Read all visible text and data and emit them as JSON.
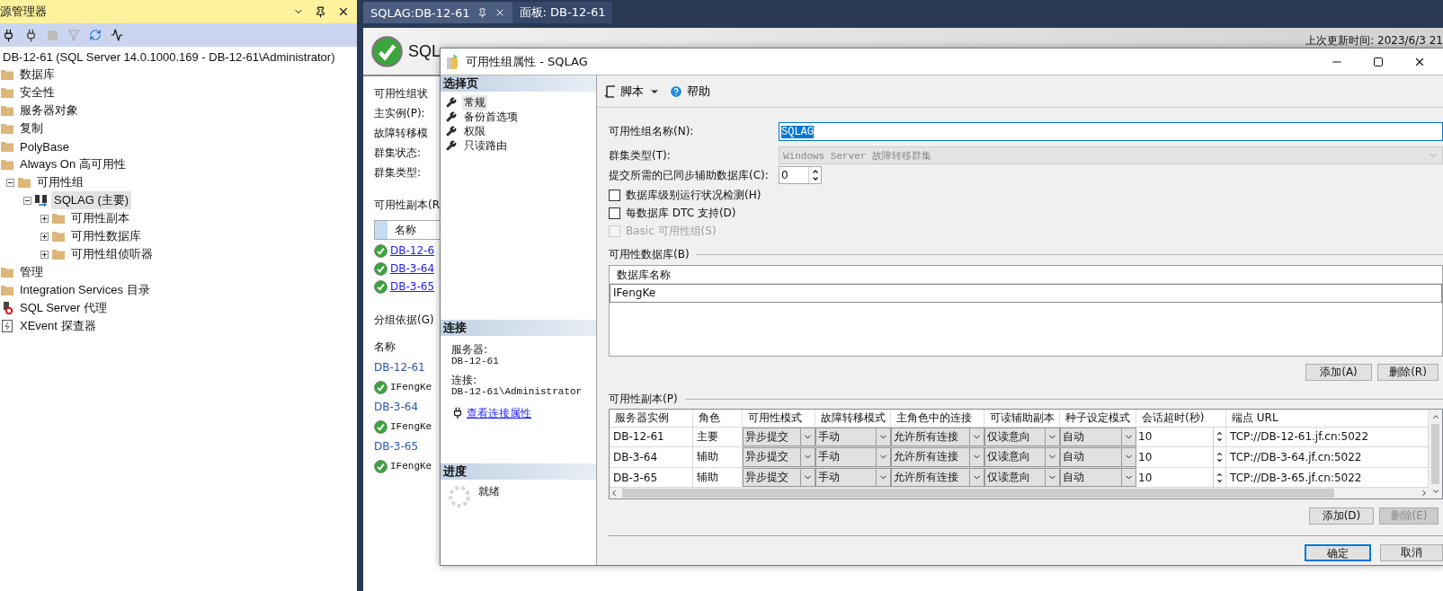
{
  "object_explorer": {
    "title": "源管理器",
    "tree": [
      {
        "label": "DB-12-61 (SQL Server 14.0.1000.169 - DB-12-61\\Administrator)",
        "selected": false,
        "children": [
          {
            "label": "数据库",
            "kind": "folder",
            "selected": false
          },
          {
            "label": "安全性",
            "kind": "folder",
            "selected": false
          },
          {
            "label": "服务器对象",
            "kind": "folder",
            "selected": false
          },
          {
            "label": "复制",
            "kind": "folder",
            "selected": false
          },
          {
            "label": "PolyBase",
            "kind": "folder",
            "selected": false
          },
          {
            "label": "Always On 高可用性",
            "kind": "folder",
            "selected": false,
            "children": [
              {
                "label": "可用性组",
                "kind": "folder",
                "selected": false,
                "expanded": true,
                "children": [
                  {
                    "label": "SQLAG (主要)",
                    "kind": "availability-group",
                    "selected": true,
                    "expanded": true,
                    "children": [
                      {
                        "label": "可用性副本",
                        "kind": "folder",
                        "selected": false,
                        "expanded": false
                      },
                      {
                        "label": "可用性数据库",
                        "kind": "folder",
                        "selected": false,
                        "expanded": false
                      },
                      {
                        "label": "可用性组侦听器",
                        "kind": "folder",
                        "selected": false,
                        "expanded": false
                      }
                    ]
                  }
                ]
              }
            ]
          },
          {
            "label": "管理",
            "kind": "folder",
            "selected": false
          },
          {
            "label": "Integration Services 目录",
            "kind": "folder",
            "selected": false
          },
          {
            "label": "SQL Server 代理",
            "kind": "agent",
            "selected": false
          },
          {
            "label": "XEvent 探查器",
            "kind": "xevent",
            "selected": false
          }
        ]
      }
    ]
  },
  "tabs": [
    {
      "label": "SQLAG:DB-12-61",
      "selected": true
    },
    {
      "label": "面板: DB-12-61",
      "selected": false
    }
  ],
  "dashboard": {
    "title": "SQL",
    "updated": "上次更新时间: 2023/6/3 21",
    "summary": [
      "可用性组状",
      "主实例(P):",
      "故障转移模",
      "群集状态:",
      "群集类型:"
    ],
    "replicas_title": "可用性副本(R",
    "replicas_column": "名称",
    "replicas": [
      "DB-12-6",
      "DB-3-64",
      "DB-3-65"
    ],
    "group_by": "分组依据(G)",
    "groups_column": "名称",
    "groups": [
      {
        "name": "DB-12-61",
        "databases": [
          "IFengKe"
        ]
      },
      {
        "name": "DB-3-64",
        "databases": [
          "IFengKe"
        ]
      },
      {
        "name": "DB-3-65",
        "databases": [
          "IFengKe"
        ]
      }
    ]
  },
  "dialog": {
    "title": "可用性组属性 - SQLAG",
    "select_page": {
      "header": "选择页",
      "items": [
        {
          "label": "常规",
          "selected": true
        },
        {
          "label": "备份首选项",
          "selected": false
        },
        {
          "label": "权限",
          "selected": false
        },
        {
          "label": "只读路由",
          "selected": false
        }
      ]
    },
    "connection": {
      "header": "连接",
      "server_label": "服务器:",
      "server": "DB-12-61",
      "connection_label": "连接:",
      "connection": "DB-12-61\\Administrator",
      "link": "查看连接属性"
    },
    "progress": {
      "header": "进度",
      "status": "就绪"
    },
    "toolbar": {
      "script": "脚本",
      "help": "帮助"
    },
    "name": {
      "label": "可用性组名称(N):",
      "value": "SQLAG"
    },
    "cluster_type": {
      "label": "群集类型(T):",
      "value": "Windows Server 故障转移群集",
      "disabled": true
    },
    "commit": {
      "label": "提交所需的已同步辅助数据库(C):",
      "value": "0"
    },
    "checkboxes": [
      {
        "label": "数据库级别运行状况检测(H)",
        "checked": false,
        "disabled": false
      },
      {
        "label": "每数据库 DTC 支持(D)",
        "checked": false,
        "disabled": false
      },
      {
        "label": "Basic 可用性组(S)",
        "checked": false,
        "disabled": true
      }
    ],
    "databases": {
      "title": "可用性数据库(B)",
      "column": "数据库名称",
      "rows": [
        "IFengKe"
      ],
      "buttons": [
        {
          "label": "添加(A)",
          "disabled": false
        },
        {
          "label": "删除(R)",
          "disabled": false
        }
      ]
    },
    "replicas": {
      "title": "可用性副本(P)",
      "columns": [
        {
          "label": "服务器实例",
          "kind": "text"
        },
        {
          "label": "角色",
          "kind": "text"
        },
        {
          "label": "可用性模式",
          "kind": "combo"
        },
        {
          "label": "故障转移模式",
          "kind": "combo"
        },
        {
          "label": "主角色中的连接",
          "kind": "combo"
        },
        {
          "label": "可读辅助副本",
          "kind": "combo"
        },
        {
          "label": "种子设定模式",
          "kind": "combo"
        },
        {
          "label": "会话超时(秒)",
          "kind": "spinner"
        },
        {
          "label": "端点 URL",
          "kind": "text"
        }
      ],
      "rows": [
        [
          "DB-12-61",
          "主要",
          "异步提交",
          "手动",
          "允许所有连接",
          "仅读意向",
          "自动",
          "10",
          "TCP://DB-12-61.jf.cn:5022"
        ],
        [
          "DB-3-64",
          "辅助",
          "异步提交",
          "手动",
          "允许所有连接",
          "仅读意向",
          "自动",
          "10",
          "TCP://DB-3-64.jf.cn:5022"
        ],
        [
          "DB-3-65",
          "辅助",
          "异步提交",
          "手动",
          "允许所有连接",
          "仅读意向",
          "自动",
          "10",
          "TCP://DB-3-65.jf.cn:5022"
        ]
      ],
      "buttons": [
        {
          "label": "添加(D)",
          "disabled": false
        },
        {
          "label": "删除(E)",
          "disabled": true
        }
      ]
    },
    "footer": [
      {
        "label": "确定",
        "focused": true
      },
      {
        "label": "取消",
        "focused": false
      }
    ]
  }
}
